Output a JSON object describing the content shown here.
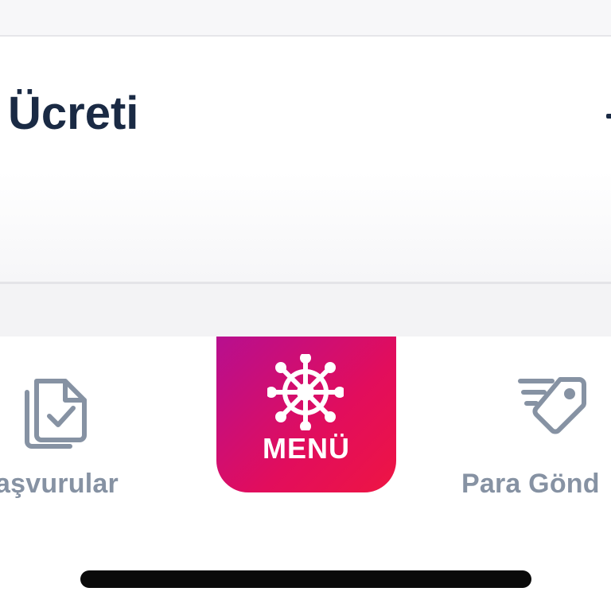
{
  "card": {
    "title": "Ücreti"
  },
  "tabbar": {
    "left": {
      "label": "aşvurular",
      "icon": "documents-check-icon"
    },
    "center": {
      "label": "MENÜ",
      "icon": "ship-wheel-icon"
    },
    "right": {
      "label": "Para Gönd",
      "icon": "send-money-tag-icon"
    }
  },
  "colors": {
    "title_text": "#1a2a44",
    "tab_text": "#8692a3",
    "menu_gradient_start": "#b70f8f",
    "menu_gradient_end": "#ee1543"
  }
}
